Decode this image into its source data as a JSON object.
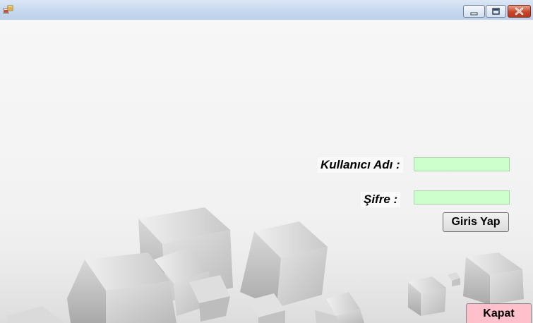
{
  "window": {
    "icon": "app-icon",
    "controls": {
      "minimize": "minimize-icon",
      "maximize": "maximize-icon",
      "close": "close-icon"
    }
  },
  "form": {
    "username_label": "Kullanıcı Adı :",
    "username_value": "",
    "password_label": "Şifre :",
    "password_value": "",
    "login_button": "Giris Yap",
    "close_button": "Kapat"
  },
  "colors": {
    "input_bg": "#ccffcc",
    "close_button_bg": "#ffc0cb",
    "titlebar": "#c6d8ee"
  }
}
